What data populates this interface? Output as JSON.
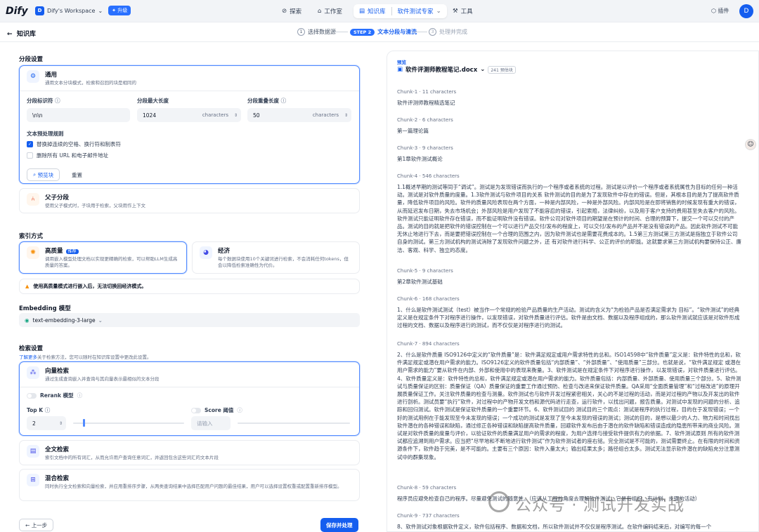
{
  "topbar": {
    "logo": "Dify",
    "workspace": "Dify's Workspace",
    "workspace_initial": "D",
    "upgrade": "升级",
    "nav": {
      "explore": "探索",
      "studio": "工作室",
      "knowledge": "知识库",
      "dataset": "软件测试专家",
      "tools": "工具"
    },
    "plugins": "插件",
    "user_initial": "D"
  },
  "subbar": {
    "back": "知识库",
    "steps": [
      {
        "num": "1",
        "label": "选择数据源"
      },
      {
        "num": "STEP 2",
        "label": "文本分段与清洗"
      },
      {
        "num": "3",
        "label": "处理并完成"
      }
    ]
  },
  "segment": {
    "title": "分段设置",
    "general": {
      "title": "通用",
      "desc": "通用文本分块模式，检索和召回的块是相同的",
      "delimiter_label": "分段标识符",
      "delimiter_value": "\\n\\n",
      "maxlen_label": "分段最大长度",
      "maxlen_value": "1024",
      "maxlen_unit": "characters",
      "overlap_label": "分段重叠长度",
      "overlap_value": "50",
      "overlap_unit": "characters",
      "rules_label": "文本预处理规则",
      "rule1": "替换掉连续的空格、换行符和制表符",
      "rule2": "删除所有 URL 和电子邮件地址",
      "preview_btn": "预览块",
      "reset_btn": "重置"
    },
    "parent_child": {
      "title": "父子分段",
      "desc": "使用父子模式时，子块用于检索，父块用作上下文"
    }
  },
  "index": {
    "title": "索引方式",
    "high": {
      "title": "高质量",
      "tag": "推荐",
      "desc": "调用嵌入模型处理文档以实现更精确的检索，可以帮助LLM生成高质量的答案。"
    },
    "eco": {
      "title": "经济",
      "desc": "每个数据块使用10个关键词进行检索，不会消耗任何tokens，但会以降低检索准确性为代价。"
    },
    "warning": "使用高质量模式进行嵌入后，无法切换回经济模式。"
  },
  "embedding": {
    "title": "Embedding 模型",
    "model": "text-embedding-3-large"
  },
  "retrieval": {
    "title": "检索设置",
    "learn_more": "了解更多",
    "hint": "关于检索方法，您可以随时在知识库设置中更改此设置。",
    "vector": {
      "title": "向量检索",
      "desc": "通过生成查询嵌入并查询与其向量表示最相似的文本分段",
      "rerank": "Rerank 模型",
      "topk_label": "Top K",
      "topk_value": "2",
      "score_label": "Score 阈值",
      "score_placeholder": "请输入"
    },
    "fulltext": {
      "title": "全文检索",
      "desc": "索引文档中的所有词汇，从而允许用户查询任意词汇，并返回包含这些词汇的文本片段"
    },
    "hybrid": {
      "title": "混合检索",
      "tag": "推荐",
      "desc": "同时执行全文检索和向量检索，并应用重排序步骤，从两类查询结果中选择匹配用户问题的最佳结果，用户可以选择设置权重或配置重新排序模型。"
    }
  },
  "footer": {
    "prev": "上一步",
    "save": "保存并处理"
  },
  "preview": {
    "label": "预览",
    "file": "软件评测师教程笔记.docx",
    "count": "241 预估块",
    "chunks": [
      {
        "head": "Chunk-1 · 11 characters",
        "text": "软件评测师教程精选笔记"
      },
      {
        "head": "Chunk-2 · 6 characters",
        "text": "第一篇理论篇"
      },
      {
        "head": "Chunk-3 · 9 characters",
        "text": "第1章软件测试概论"
      },
      {
        "head": "Chunk-4 · 546 characters",
        "text": "1.1概述早期的测试等同于“调试”。测试是为发现错误而执行的一个程序或者系统的过程。测试是以评价一个程序或者系统属性为目标的任何一种活动。测试是对软件质量的度量。1.3软件测试与软件项目的关系 软件测试的目的是为了发现软件中存在的错误。但是，其根本目的是为了提高软件质量，降低软件项目的风险。软件的质量风险表现在两个方面，一种是内部风险，一种是外部风险。内部风险是在即将销售的时候发现有重大的错误，从而延迟发布日期，失去市场机会；外部风险是用户发现了不能容忍的错误，引起索赔，法律纠纷，以及用于客户支持的费用甚至失去客户的风险。软件测试只能证明软件存在错误，而不能证明软件没有错误。软件公司对软件项目的期望是在预计的时间、合理的预算下，提交一个可以交付的产品。测试的目的就是把软件的错误控制在一个可以进行产品交付/发布的程度上，可以交付/发布的产品并不是没有错误的产品。因此软件测试不可能无休止地进行下去，而是要把错误控制在一个合理的范围之内，因为软件测试也是需要花费成本的。1.5第三方测试第三方测试是指独立于软件公司自身的测试。第三方测试机构的测试消除了发现软件问题之外，还 有对软件进行科学、公正的评价的职能。这就要求第三方测试机构要保持公正、廉洁、客观、科学、独立的态度。"
      },
      {
        "head": "Chunk-5 · 9 characters",
        "text": "第2章软件测试基础"
      },
      {
        "head": "Chunk-6 · 168 characters",
        "text": "1、什么是软件测试测试（test）被当作一个常规的检验产品质量的生产活动。测试的含义为“为检验产品是否满足需求为 目标”。“软件测试”的经典定义是在规定条件下对程序进行操作，以发现错误，对软件质量进行评估。软件是由文档、数据以及程序组成的，那么软件测试就应该是对软件形成过程的文档、数据以及程序进行的测试，而不仅仅是对程序进行的测试。"
      },
      {
        "head": "Chunk-7 · 894 characters",
        "text": "2、什么是软件质量 ISO9126中定义的“软件质量”是：软件满足规定或用户需求特性的总和。ISO14598中“软件质量”定义是：软件特性的总和，软件满足规定或潜在用户需求的能力。ISO9126定义的软件质量包括“内部质量”、“外部质量”、“使用质量”三部分。也就是说，“软件满足规定 或潜在用户需求的能力”要从软件在内部、外部和使用中的表现来衡量。3、软件测试是在规定条件下对程序进行操作，以发现错误，对软件质量进行评估。4、软件质量定义是：软件特性的总和，软件满足规定或潜在用户需求的能力。软件质量包括：内部质量、外部质量、使用质量三个部分。5、软件测试与质量保证的区别：质量保证（QA）质量保证的重要工作通过预防、检查与改进来保证软件质量。QA采用“全面质量管理”和“过程改进”的原理开展质量保证工作。关注软件质量的检查与测量。软件测试也与软件开发过程紧密相关，关心的不是过程的活动，而是对过程的产物以及开发出的软件进行剖析。测试员要“执行”软件，对过程中的产物开发文档和源代码进行走查，运行软件，以找出问题，报告质量。对测试中发现的问题的分析、追踪和回归测试。软件测试是保证软件质量的一个重要环节。6、软件测试目的 测试目的三个观点：测试是程序的执行过程，目的在于发现错误；一个好的测试用例在于能发现至今未发现的错误；一个成功的测试是发现了至今未发现的错误的测试；测试的目的，是想以最少的人力、物力和时间找出软件潜在的各种错误和缺陷，通过修正各种错误和缺陷提高软件质量，回避软件发布后由于潜在的软件缺陷和错误造成的隐患所带来的商业风险。测试是对软件质量的度量与评价，以验证软件的质量满足用户的需求的程度，为用户选择与接受软件提供有力的依据。7、软件测试原则 所有的软件测试都应追溯到用户需求。应当把“尽早地和不断地进行软件测试”作为软件测试者的座右铭。完全测试是不可能的，测试需要终止。在有限的时间和资源条件下，软件趋于完美，是不可能的。主要有三个原因：软件入量太大；输出结果太多；路径组合太多。测试无法显示软件潜在的缺陷充分注意测试中的群集现象。"
      },
      {
        "head": "Chunk-8 · 59 characters",
        "text": "程序员应避免检查自己的程序。尽量避免测试的随意性。（应该从工程的角度去理解软件测试，它是有组织、有计划、步骤的活动）"
      },
      {
        "head": "Chunk-9 · 737 characters",
        "text": "8、软件测试对象根据软件定义，软件包括程序、数据和文档，所以软件测试并不仅仅是程序测试。在软件编码结束后，对编写的每一个"
      }
    ]
  },
  "watermark": "公众号 · 测试开发实战"
}
